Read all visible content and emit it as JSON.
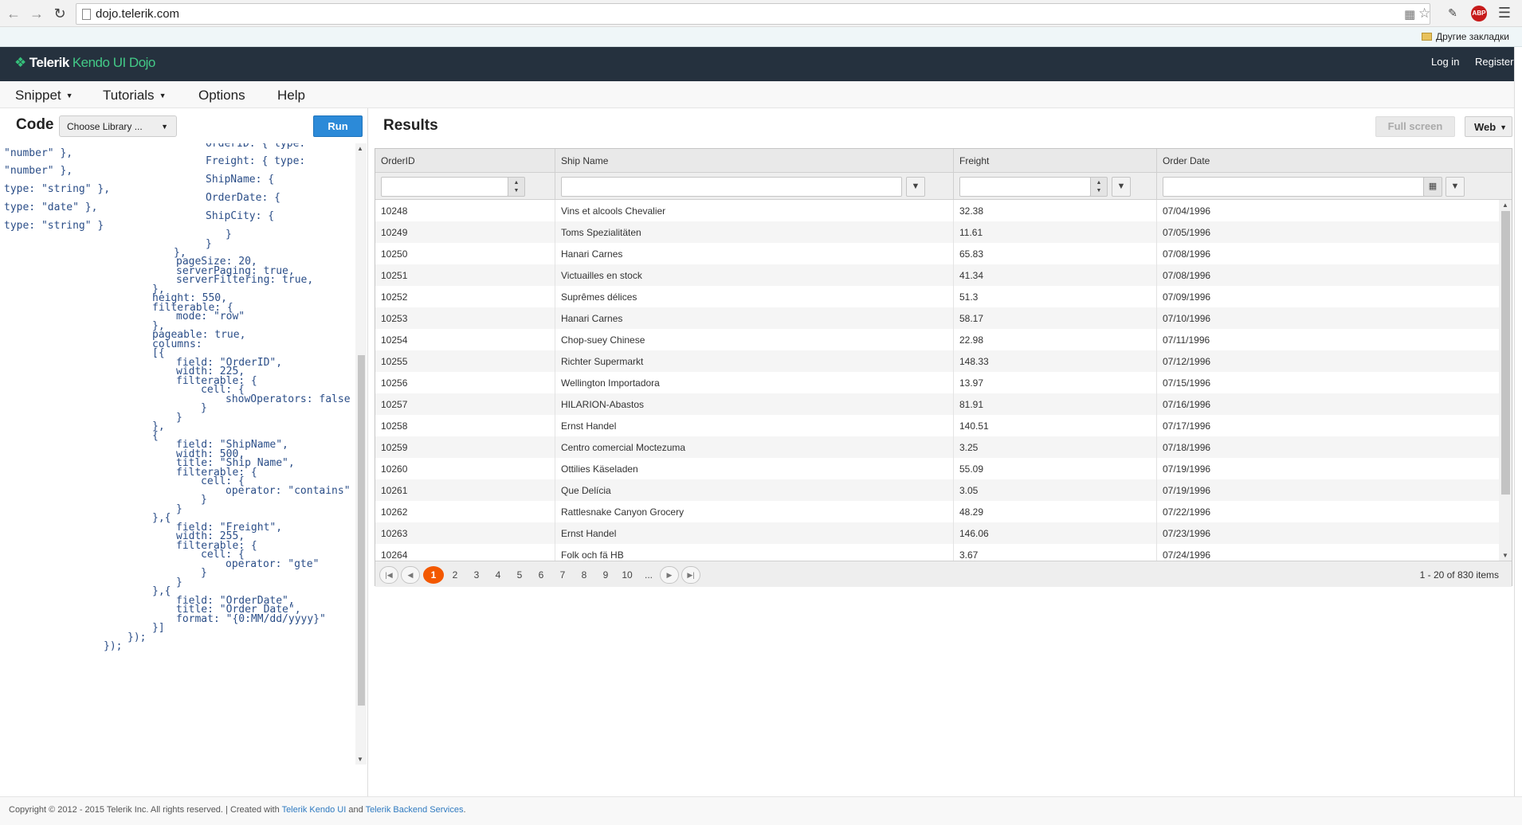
{
  "browser": {
    "url": "dojo.telerik.com",
    "bookmarks_folder": "Другие закладки",
    "abp_label": "ABP",
    "back_icon": "arrow-left-icon",
    "forward_icon": "arrow-right-icon",
    "reload_icon": "reload-icon",
    "menu_icon": "hamburger-menu-icon"
  },
  "header": {
    "logo_brand": "Telerik",
    "logo_product": "Kendo UI Dojo",
    "login": "Log in",
    "register": "Register",
    "background": "#25313e",
    "accent": "#43c987"
  },
  "menu": {
    "items": [
      {
        "label": "Snippet",
        "has_caret": true
      },
      {
        "label": "Tutorials",
        "has_caret": true
      },
      {
        "label": "Options",
        "has_caret": false
      },
      {
        "label": "Help",
        "has_caret": false
      }
    ]
  },
  "code_pane": {
    "title": "Code",
    "library_select": "Choose Library ...",
    "run_label": "Run",
    "run_color": "#2c8ad8",
    "lines": [
      "\"number\" },",
      "OrderID: { type:",
      "Freight: { type:",
      "\"number\" },",
      "ShipName: {",
      "type: \"string\" },",
      "OrderDate: {",
      "type: \"date\" },",
      "ShipCity: {",
      "type: \"string\" }",
      "}",
      "}",
      "},",
      "pageSize: 20,",
      "serverPaging: true,",
      "serverFiltering: true,",
      "},",
      "height: 550,",
      "filterable: {",
      "mode: \"row\"",
      "},",
      "pageable: true,",
      "columns:",
      "[{",
      "field: \"OrderID\",",
      "width: 225,",
      "filterable: {",
      "cell: {",
      "showOperators: false",
      "}",
      "}",
      "},",
      "{",
      "field: \"ShipName\",",
      "width: 500,",
      "title: \"Ship Name\",",
      "filterable: {",
      "cell: {",
      "operator: \"contains\"",
      "}",
      "}",
      "},{",
      "field: \"Freight\",",
      "width: 255,",
      "filterable: {",
      "cell: {",
      "operator: \"gte\"",
      "}",
      "}",
      "},{",
      "field: \"OrderDate\",",
      "title: \"Order Date\",",
      "format: \"{0:MM/dd/yyyy}\"",
      "}]",
      "});",
      "});"
    ]
  },
  "results": {
    "title": "Results",
    "fullscreen_label": "Full screen",
    "view_select": "Web",
    "grid": {
      "columns": [
        "OrderID",
        "Ship Name",
        "Freight",
        "Order Date"
      ],
      "rows": [
        [
          "10248",
          "Vins et alcools Chevalier",
          "32.38",
          "07/04/1996"
        ],
        [
          "10249",
          "Toms Spezialitäten",
          "11.61",
          "07/05/1996"
        ],
        [
          "10250",
          "Hanari Carnes",
          "65.83",
          "07/08/1996"
        ],
        [
          "10251",
          "Victuailles en stock",
          "41.34",
          "07/08/1996"
        ],
        [
          "10252",
          "Suprêmes délices",
          "51.3",
          "07/09/1996"
        ],
        [
          "10253",
          "Hanari Carnes",
          "58.17",
          "07/10/1996"
        ],
        [
          "10254",
          "Chop-suey Chinese",
          "22.98",
          "07/11/1996"
        ],
        [
          "10255",
          "Richter Supermarkt",
          "148.33",
          "07/12/1996"
        ],
        [
          "10256",
          "Wellington Importadora",
          "13.97",
          "07/15/1996"
        ],
        [
          "10257",
          "HILARION-Abastos",
          "81.91",
          "07/16/1996"
        ],
        [
          "10258",
          "Ernst Handel",
          "140.51",
          "07/17/1996"
        ],
        [
          "10259",
          "Centro comercial Moctezuma",
          "3.25",
          "07/18/1996"
        ],
        [
          "10260",
          "Ottilies Käseladen",
          "55.09",
          "07/19/1996"
        ],
        [
          "10261",
          "Que Delícia",
          "3.05",
          "07/19/1996"
        ],
        [
          "10262",
          "Rattlesnake Canyon Grocery",
          "48.29",
          "07/22/1996"
        ],
        [
          "10263",
          "Ernst Handel",
          "146.06",
          "07/23/1996"
        ],
        [
          "10264",
          "Folk och fä HB",
          "3.67",
          "07/24/1996"
        ]
      ]
    },
    "pager": {
      "pages": [
        "1",
        "2",
        "3",
        "4",
        "5",
        "6",
        "7",
        "8",
        "9",
        "10",
        "..."
      ],
      "current_page": "1",
      "info": "1 - 20 of 830 items",
      "active_color": "#f35800"
    }
  },
  "footer": {
    "copyright": "Copyright © 2012 - 2015 Telerik Inc. All rights reserved. | Created with",
    "link1": "Telerik Kendo UI",
    "and": "and",
    "link2": "Telerik Backend Services",
    "period": "."
  }
}
